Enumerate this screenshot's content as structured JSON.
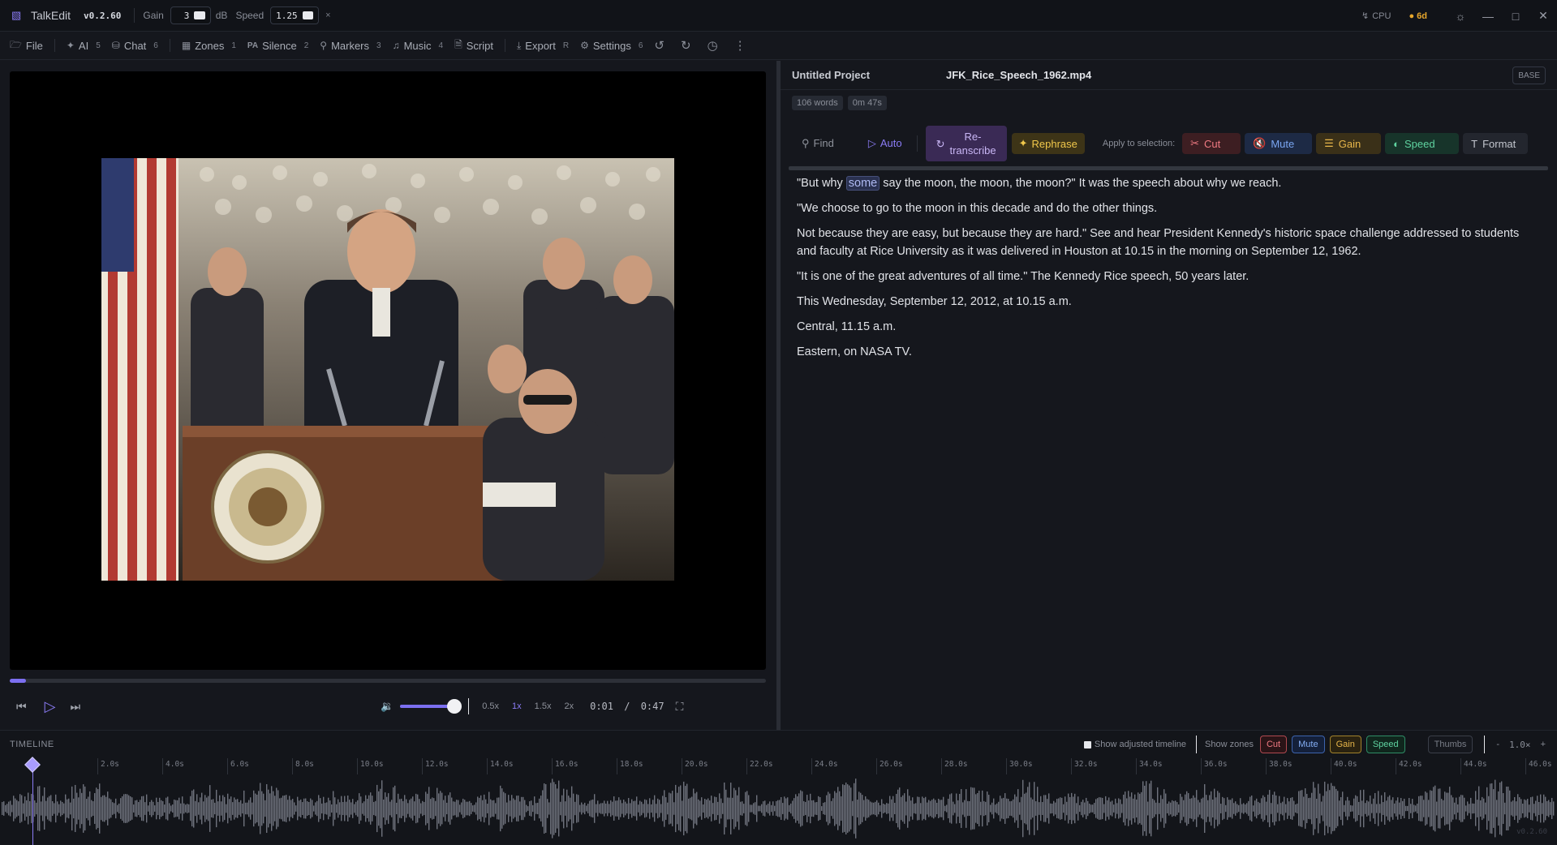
{
  "titlebar": {
    "app_name": "TalkEdit",
    "version": "v0.2.60",
    "gain_label": "Gain",
    "gain_value": "3",
    "gain_unit": "dB",
    "speed_label": "Speed",
    "speed_value": "1.25",
    "close_x": "×",
    "cpu_label": "CPU",
    "status_badge": "6d"
  },
  "toolbar": {
    "file": "File",
    "ai": "AI",
    "ai_count": "5",
    "chat": "Chat",
    "chat_count": "6",
    "zones": "Zones",
    "zones_count": "1",
    "silence_prefix": "PA",
    "silence": "Silence",
    "silence_count": "2",
    "markers": "Markers",
    "markers_count": "3",
    "music": "Music",
    "music_count": "4",
    "script": "Script",
    "export": "Export",
    "export_count": "R",
    "settings": "Settings",
    "settings_count": "6"
  },
  "player": {
    "progress_fraction": 0.021,
    "time_current": "0:01",
    "time_sep": "/",
    "time_total": "0:47",
    "rates": [
      "0.5x",
      "1x",
      "1.5x",
      "2x"
    ],
    "active_rate": "1x",
    "volume_fraction": 0.95
  },
  "project": {
    "name": "Untitled Project",
    "file": "JFK_Rice_Speech_1962.mp4",
    "base_label": "BASE",
    "word_count": "106 words",
    "duration": "0m 47s"
  },
  "actions": {
    "find": "Find",
    "auto": "Auto",
    "retranscribe_line1": "Re-",
    "retranscribe_line2": "transcribe",
    "rephrase": "Rephrase",
    "apply_label": "Apply to selection:",
    "cut": "Cut",
    "mute": "Mute",
    "gain": "Gain",
    "speed": "Speed",
    "format": "Format"
  },
  "transcript": {
    "p1_before": "\"But why",
    "p1_highlight": "some",
    "p1_after": "say the moon, the moon, the moon?\" It was the speech about why we reach.",
    "p2": "\"We choose to go to the moon in this decade and do the other things.",
    "p3": "Not because they are easy, but because they are hard.\" See and hear President Kennedy's historic space challenge addressed to students and faculty at Rice University as it was delivered in Houston at 10.15 in the morning on September 12, 1962.",
    "p4": "\"It is one of the great adventures of all time.\" The Kennedy Rice speech, 50 years later.",
    "p5": "This Wednesday, September 12, 2012, at 10.15 a.m.",
    "p6": "Central, 11.15 a.m.",
    "p7": "Eastern, on NASA TV."
  },
  "timeline": {
    "label": "TIMELINE",
    "show_adjusted": "Show adjusted timeline",
    "show_zones": "Show zones",
    "cut": "Cut",
    "mute": "Mute",
    "gain": "Gain",
    "speed": "Speed",
    "thumbs": "Thumbs",
    "zoom_minus": "-",
    "zoom_value": "1.0×",
    "zoom_plus": "+",
    "ticks": [
      "2.0s",
      "4.0s",
      "6.0s",
      "8.0s",
      "10.0s",
      "12.0s",
      "14.0s",
      "16.0s",
      "18.0s",
      "20.0s",
      "22.0s",
      "24.0s",
      "26.0s",
      "28.0s",
      "30.0s",
      "32.0s",
      "34.0s",
      "36.0s",
      "38.0s",
      "40.0s",
      "42.0s",
      "44.0s",
      "46.0s"
    ],
    "footer_version": "v0.2.60"
  },
  "colors": {
    "accent": "#8b7cf6",
    "cut": "#f07a82",
    "mute": "#7aa6f2",
    "gain": "#e8b64a",
    "speed": "#5fd3a0"
  }
}
